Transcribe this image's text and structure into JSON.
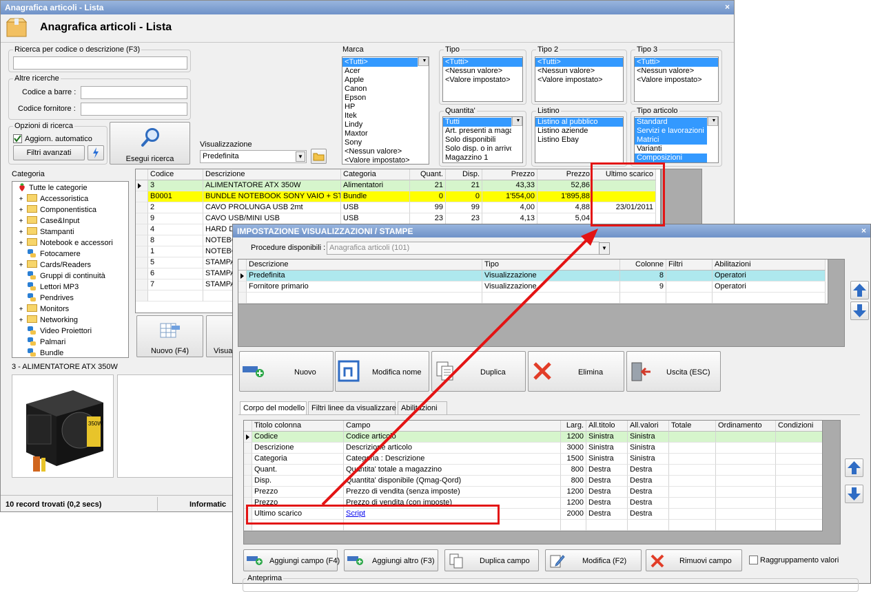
{
  "window": {
    "titlebar": "Anagrafica articoli  - Lista",
    "close": "×",
    "heading": "Anagrafica articoli  - Lista"
  },
  "search": {
    "legend": "Ricerca per codice o descrizione (F3)",
    "value": ""
  },
  "altre": {
    "legend": "Altre ricerche",
    "barcode_label": "Codice a barre :",
    "supplier_label": "Codice fornitore :"
  },
  "opzioni": {
    "legend": "Opzioni di ricerca",
    "auto_label": "Aggiorn. automatico",
    "filters_button": "Filtri avanzati",
    "run_button": "Esegui ricerca"
  },
  "visual": {
    "legend": "Visualizzazione",
    "value": "Predefinita"
  },
  "marca": {
    "legend": "Marca",
    "items": [
      "<Tutti>",
      "Acer",
      "Apple",
      "Canon",
      "Epson",
      "HP",
      "Itek",
      "Lindy",
      "Maxtor",
      "Sony",
      "<Nessun valore>",
      "<Valore impostato>"
    ]
  },
  "tipo": {
    "legend": "Tipo",
    "items": [
      "<Tutti>",
      "<Nessun valore>",
      "<Valore impostato>"
    ]
  },
  "tipo2": {
    "legend": "Tipo 2",
    "items": [
      "<Tutti>",
      "<Nessun valore>",
      "<Valore impostato>"
    ]
  },
  "tipo3": {
    "legend": "Tipo 3",
    "items": [
      "<Tutti>",
      "<Nessun valore>",
      "<Valore impostato>"
    ]
  },
  "quantita": {
    "legend": "Quantita'",
    "items": [
      "Tutti",
      "Art. presenti a magazzino",
      "Solo disponibili",
      "Solo disp. o in arrivo",
      "Magazzino 1"
    ]
  },
  "listino": {
    "legend": "Listino",
    "items": [
      "Listino al pubblico",
      "Listino aziende",
      "Listino Ebay"
    ]
  },
  "tipoart": {
    "legend": "Tipo articolo",
    "items": [
      "Standard",
      "Servizi e lavorazioni",
      "Matrici",
      "Varianti",
      "Composizioni"
    ]
  },
  "categoria": {
    "legend": "Categoria",
    "root": "Tutte le categorie",
    "items": [
      {
        "label": "Accessoristica",
        "type": "folder"
      },
      {
        "label": "Componentistica",
        "type": "folder"
      },
      {
        "label": "Case&Input",
        "type": "folder"
      },
      {
        "label": "Stampanti",
        "type": "folder"
      },
      {
        "label": "Notebook e accessori",
        "type": "folder"
      },
      {
        "label": "Fotocamere",
        "type": "net"
      },
      {
        "label": "Cards/Readers",
        "type": "folder"
      },
      {
        "label": "Gruppi di continuità",
        "type": "net"
      },
      {
        "label": "Lettori MP3",
        "type": "net"
      },
      {
        "label": "Pendrives",
        "type": "net"
      },
      {
        "label": "Monitors",
        "type": "folder"
      },
      {
        "label": "Networking",
        "type": "folder"
      },
      {
        "label": "Video Proiettori",
        "type": "net"
      },
      {
        "label": "Palmari",
        "type": "net"
      },
      {
        "label": "Bundle",
        "type": "net"
      }
    ]
  },
  "grid": {
    "headers": [
      "Codice",
      "Descrizione",
      "Categoria",
      "Quant.",
      "Disp.",
      "Prezzo",
      "Prezzo",
      "Ultimo scarico"
    ],
    "rows": [
      [
        "3",
        "ALIMENTATORE ATX 350W",
        "Alimentatori",
        "21",
        "21",
        "43,33",
        "52,86",
        ""
      ],
      [
        "B0001",
        "BUNDLE NOTEBOOK SONY VAIO + ST...",
        "Bundle",
        "0",
        "0",
        "1'554,00",
        "1'895,88",
        ""
      ],
      [
        "2",
        "CAVO PROLUNGA USB 2mt",
        "USB",
        "99",
        "99",
        "4,00",
        "4,88",
        "23/01/2011"
      ],
      [
        "9",
        "CAVO USB/MINI USB",
        "USB",
        "23",
        "23",
        "4,13",
        "5,04",
        ""
      ],
      [
        "4",
        "HARD D",
        "",
        "",
        "",
        "",
        "",
        ""
      ],
      [
        "8",
        "NOTEBO",
        "",
        "",
        "",
        "",
        "",
        ""
      ],
      [
        "1",
        "NOTEBO",
        "",
        "",
        "",
        "",
        "",
        ""
      ],
      [
        "5",
        "STAMPA",
        "",
        "",
        "",
        "",
        "",
        ""
      ],
      [
        "6",
        "STAMPA",
        "",
        "",
        "",
        "",
        "",
        ""
      ],
      [
        "7",
        "STAMPA",
        "",
        "",
        "",
        "",
        "",
        ""
      ]
    ]
  },
  "main_buttons": {
    "nuovo": "Nuovo (F4)",
    "visual": "Visual"
  },
  "preview": {
    "legend": "3 - ALIMENTATORE ATX 350W",
    "psu_label": "350W"
  },
  "status": {
    "records": "10 record trovati (0,2 secs)",
    "info": "Informatic"
  },
  "dialog": {
    "title": "IMPOSTAZIONE VISUALIZZAZIONI / STAMPE",
    "close": "×",
    "proc_label": "Procedure disponibili :",
    "proc_value": "Anagrafica articoli (101)",
    "views_headers": [
      "Descrizione",
      "Tipo",
      "Colonne",
      "Filtri",
      "Abilitazioni"
    ],
    "views_rows": [
      [
        "Predefinita",
        "Visualizzazione",
        "8",
        "",
        "Operatori"
      ],
      [
        "Fornitore primario",
        "Visualizzazione",
        "9",
        "",
        "Operatori"
      ]
    ],
    "buttons": {
      "nuovo": "Nuovo",
      "modifica": "Modifica nome",
      "duplica": "Duplica",
      "elimina": "Elimina",
      "uscita": "Uscita (ESC)"
    },
    "tabs": [
      "Corpo del modello",
      "Filtri linee da visualizzare",
      "Abilitazioni"
    ],
    "fields_headers": [
      "Titolo colonna",
      "Campo",
      "Larg.",
      "All.titolo",
      "All.valori",
      "Totale",
      "Ordinamento",
      "Condizioni"
    ],
    "fields_rows": [
      [
        "Codice",
        "Codice articolo",
        "1200",
        "Sinistra",
        "Sinistra"
      ],
      [
        "Descrizione",
        "Descrizione articolo",
        "3000",
        "Sinistra",
        "Sinistra"
      ],
      [
        "Categoria",
        "Categoria : Descrizione",
        "1500",
        "Sinistra",
        "Sinistra"
      ],
      [
        "Quant.",
        "Quantita' totale a magazzino",
        "800",
        "Destra",
        "Destra"
      ],
      [
        "Disp.",
        "Quantita' disponibile (Qmag-Qord)",
        "800",
        "Destra",
        "Destra"
      ],
      [
        "Prezzo",
        "Prezzo di vendita (senza imposte)",
        "1200",
        "Destra",
        "Destra"
      ],
      [
        "Prezzo",
        "Prezzo di vendita (con imposte)",
        "1200",
        "Destra",
        "Destra"
      ],
      [
        "Ultimo scarico",
        "Script",
        "2000",
        "Destra",
        "Destra"
      ]
    ],
    "bottom_buttons": {
      "aggiungi": "Aggiungi campo (F4)",
      "altro": "Aggiungi altro (F3)",
      "duplica": "Duplica campo",
      "modifica": "Modifica (F2)",
      "rimuovi": "Rimuovi campo",
      "raggruppamento": "Raggruppamento valori"
    },
    "anteprima": "Anteprima"
  },
  "colors": {
    "selection": "#3399ff",
    "green_row": "#d6f5cc",
    "yellow_row": "#ffff00",
    "cyan_row": "#aee8ee",
    "annotation": "#e31414"
  }
}
